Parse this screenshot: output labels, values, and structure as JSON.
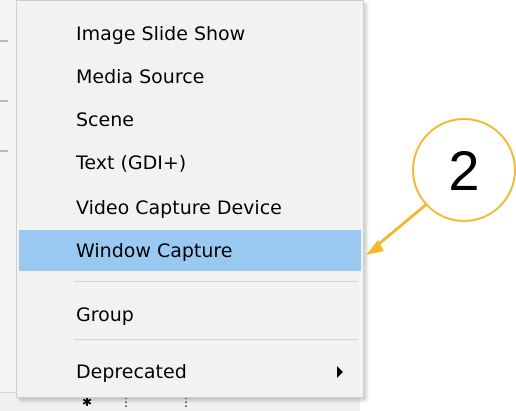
{
  "menu": {
    "items": [
      {
        "label": "Image Slide Show"
      },
      {
        "label": "Media Source"
      },
      {
        "label": "Scene"
      },
      {
        "label": "Text (GDI+)"
      },
      {
        "label": "Video Capture Device"
      },
      {
        "label": "Window Capture",
        "selected": true
      },
      {
        "label": "Group"
      },
      {
        "label": "Deprecated",
        "has_submenu": true
      }
    ]
  },
  "annotation": {
    "step_number": "2",
    "color": "#f2b82f"
  },
  "colors": {
    "highlight": "#99c9f1",
    "menu_bg": "#f2f2f2"
  }
}
